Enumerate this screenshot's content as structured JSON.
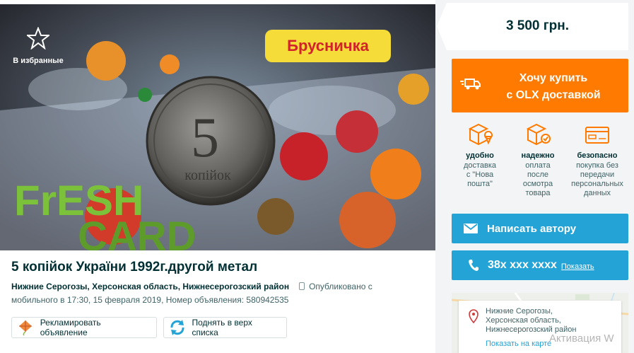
{
  "gallery": {
    "favorite_label": "В избранные",
    "card_brand": "Брусничка",
    "card_text_top": "FrESH",
    "card_text_bottom": "CARD",
    "coin_value": "5",
    "coin_word": "копійок"
  },
  "ad": {
    "title": "5 копійок України 1992г.другой метал",
    "location": "Нижние Серогозы, Херсонская область, Нижнесерогозский район",
    "published_prefix": "Опубликовано с",
    "published_source_time": "мобильного   в 17:30, 15 февраля 2019, Номер объявления: 580942535"
  },
  "actions": {
    "promote_label": "Рекламировать объявление",
    "raise_label": "Поднять в верх списка"
  },
  "sidebar": {
    "price": "3 500 грн.",
    "buy_line1": "Хочу купить",
    "buy_line2": "с OLX доставкой",
    "features": [
      {
        "title": "удобно",
        "desc1": "доставка",
        "desc2": "с \"Нова",
        "desc3": "пошта\"",
        "desc4": ""
      },
      {
        "title": "надежно",
        "desc1": "оплата",
        "desc2": "после",
        "desc3": "осмотра",
        "desc4": "товара"
      },
      {
        "title": "безопасно",
        "desc1": "покупка без",
        "desc2": "передачи",
        "desc3": "персональных",
        "desc4": "данных"
      }
    ],
    "message_label": "Написать автору",
    "phone_masked": "38x xxx xxxx",
    "phone_show": "Показать",
    "map_address_1": "Нижние Серогозы,",
    "map_address_2": "Херсонская область,",
    "map_address_3": "Нижнесерогозский район",
    "map_show": "Показать на карте",
    "watermark": "Активация W"
  },
  "colors": {
    "orange": "#ff7a00",
    "blue": "#23a3d6",
    "text": "#002f34"
  }
}
